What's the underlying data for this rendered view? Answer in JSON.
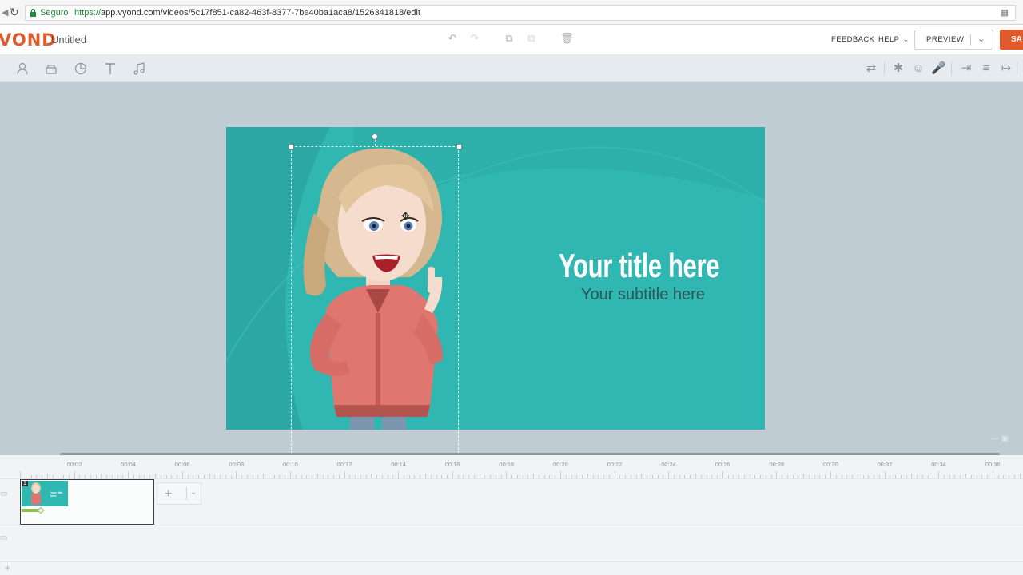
{
  "browser": {
    "secure_label": "Seguro",
    "url_scheme": "https://",
    "url_rest": "app.vyond.com/videos/5c17f851-ca82-463f-8377-7be40ba1aca8/1526341818/edit"
  },
  "app": {
    "logo": "VOND",
    "doc_title": "Untitled",
    "feedback_label": "FEEDBACK",
    "help_label": "HELP",
    "preview_label": "PREVIEW",
    "save_label": "SA"
  },
  "canvas": {
    "title": "Your title here",
    "subtitle": "Your subtitle here"
  },
  "timeline": {
    "ticks": [
      "00:02",
      "00:04",
      "00:06",
      "00:08",
      "00:10",
      "00:12",
      "00:14",
      "00:16",
      "00:18",
      "00:20",
      "00:22",
      "00:24",
      "00:26",
      "00:28",
      "00:30",
      "00:32",
      "00:34",
      "00:36"
    ],
    "scene_number": "1",
    "scene_thumb_title": "Your title here"
  },
  "colors": {
    "brand": "#e05a2b",
    "canvas_bg": "#31b7b1",
    "subtitle": "#2b5557"
  },
  "icons": {
    "left_tools": [
      "character-icon",
      "prop-icon",
      "chart-icon",
      "text-icon",
      "audio-icon"
    ],
    "right_tools": [
      "swap-icon",
      "action-icon",
      "expression-icon",
      "microphone-icon",
      "enter-effect-icon",
      "motion-path-icon",
      "exit-effect-icon"
    ],
    "header_tools": [
      "undo-icon",
      "redo-icon",
      "copy-icon",
      "paste-icon",
      "delete-icon"
    ]
  }
}
